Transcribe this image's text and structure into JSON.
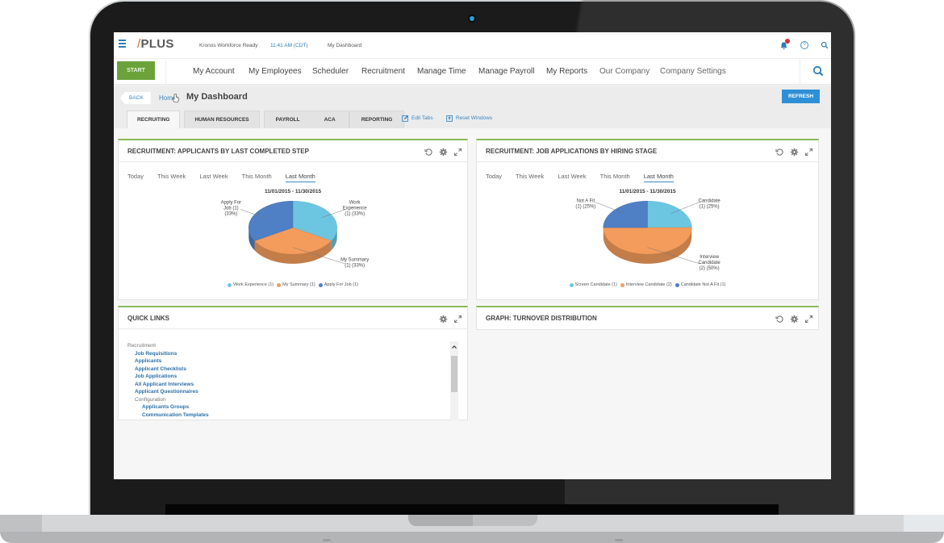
{
  "app": {
    "logo": "PLUS",
    "logo_mark": "/",
    "product": "Kronos Workforce Ready",
    "time": "11:41 AM (CDT)",
    "current_page": "My Dashboard",
    "help_glyph": "?"
  },
  "nav": {
    "start_label": "START",
    "items": [
      {
        "label": "My Account"
      },
      {
        "label": "My Employees"
      },
      {
        "label": "Scheduler"
      },
      {
        "label": "Recruitment"
      },
      {
        "label": "Manage Time"
      },
      {
        "label": "Manage Payroll"
      },
      {
        "label": "My Reports"
      },
      {
        "label": "Our Company"
      },
      {
        "label": "Company Settings"
      }
    ]
  },
  "subbar": {
    "back_label": "BACK",
    "breadcrumb_home": "Home",
    "breadcrumb_sep": "›",
    "title": "My Dashboard",
    "refresh_label": "REFRESH",
    "tabs": [
      {
        "label": "RECRUITING",
        "active": true
      },
      {
        "label": "HUMAN RESOURCES"
      },
      {
        "label": "PAYROLL"
      },
      {
        "label": "ACA"
      },
      {
        "label": "REPORTING"
      }
    ],
    "edit_tabs_label": "Edit Tabs",
    "reset_windows_label": "Reset Windows"
  },
  "widgets": {
    "applicants": {
      "title": "RECRUITMENT: APPLICANTS BY LAST COMPLETED STEP",
      "ranges": [
        "Today",
        "This Week",
        "Last Week",
        "This Month",
        "Last Month"
      ],
      "active_range": "Last Month",
      "date_range": "11/01/2015 - 11/30/2015"
    },
    "job_applications": {
      "title": "RECRUITMENT: JOB APPLICATIONS BY HIRING STAGE",
      "ranges": [
        "Today",
        "This Week",
        "Last Week",
        "This Month",
        "Last Month"
      ],
      "active_range": "Last Month",
      "date_range": "11/01/2015 - 11/30/2015"
    },
    "quick_links": {
      "title": "QUICK LINKS",
      "sections": [
        {
          "category": "Recruitment",
          "links": [
            "Job Requisitions",
            "Applicants",
            "Applicant Checklists",
            "Job Applications",
            "All Applicant Interviews",
            "Applicant Questionnaires"
          ]
        },
        {
          "category": "Configuration",
          "links": [
            "Applicants Groups",
            "Communication Templates"
          ]
        }
      ]
    },
    "turnover": {
      "title": "GRAPH: TURNOVER DISTRIBUTION"
    }
  },
  "colors": {
    "accent_blue": "#2d8fd5",
    "start_green": "#6aa33a",
    "widget_border_green": "#8ab95a",
    "link_blue": "#2a6fa8",
    "slice_light_blue": "#6cc6e2",
    "slice_orange": "#f39c5b",
    "slice_dark_blue": "#4f7fc4",
    "notification_red": "#d63031"
  },
  "chart_data": [
    {
      "type": "pie",
      "title": "RECRUITMENT: APPLICANTS BY LAST COMPLETED STEP",
      "subtitle": "11/01/2015 - 11/30/2015",
      "categories": [
        "Work Experience",
        "My Summary",
        "Apply For Job"
      ],
      "values": [
        1,
        1,
        1
      ],
      "percents": [
        33,
        33,
        33
      ],
      "labels": [
        "Work Experience (1) (33%)",
        "My Summary (1) (33%)",
        "Apply For Job (1) (33%)"
      ],
      "legend": [
        "Work Experience (1)",
        "My Summary (1)",
        "Apply For Job (1)"
      ],
      "legend_position": "bottom",
      "colors": [
        "#6cc6e2",
        "#f39c5b",
        "#4f7fc4"
      ]
    },
    {
      "type": "pie",
      "title": "RECRUITMENT: JOB APPLICATIONS BY HIRING STAGE",
      "subtitle": "11/01/2015 - 11/30/2015",
      "categories": [
        "Screen Candidate",
        "Interview Candidate",
        "Candidate Not A Fit"
      ],
      "values": [
        1,
        2,
        1
      ],
      "percents": [
        25,
        50,
        25
      ],
      "labels": [
        "Screen Candidate (1) (25%)",
        "Interview Candidate (2) (50%)",
        "Candidate Not A Fit (1) (25%)"
      ],
      "legend": [
        "Screen Candidate (1)",
        "Interview Candidate (2)",
        "Candidate Not A Fit (1)"
      ],
      "legend_position": "bottom",
      "colors": [
        "#6cc6e2",
        "#f39c5b",
        "#4f7fc4"
      ]
    }
  ]
}
